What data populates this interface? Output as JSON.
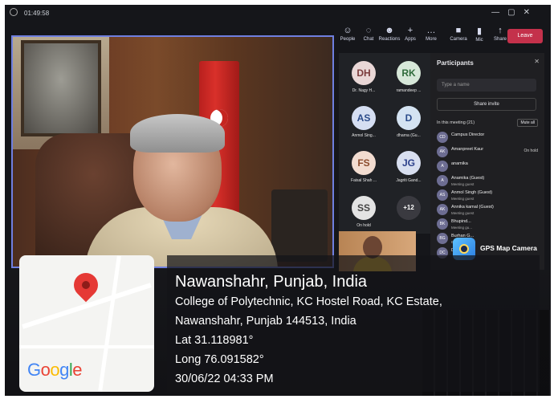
{
  "status_bar": {
    "time": "01:49:58"
  },
  "toolbar": {
    "items": [
      {
        "label": "People",
        "icon": "people-icon",
        "glyph": "☺"
      },
      {
        "label": "Chat",
        "icon": "chat-icon",
        "glyph": "◌"
      },
      {
        "label": "Reactions",
        "icon": "reactions-icon",
        "glyph": "☻"
      },
      {
        "label": "Apps",
        "icon": "apps-icon",
        "glyph": "+"
      },
      {
        "label": "More",
        "icon": "more-icon",
        "glyph": "…"
      },
      {
        "label": "Camera",
        "icon": "camera-icon",
        "glyph": "■"
      },
      {
        "label": "Mic",
        "icon": "mic-icon",
        "glyph": "▮"
      },
      {
        "label": "Share",
        "icon": "share-icon",
        "glyph": "↑"
      }
    ],
    "leave_label": "Leave"
  },
  "video_tiles": [
    {
      "initials": "DH",
      "name": "Dr. Nagy H...",
      "bg": "#e9d7d6",
      "fg": "#7a3b3b"
    },
    {
      "initials": "RK",
      "name": "ramandeep ...",
      "bg": "#d7e8d9",
      "fg": "#2f6b3b"
    },
    {
      "initials": "AS",
      "name": "Anmol Sing...",
      "bg": "#d5def2",
      "fg": "#2b4b8a"
    },
    {
      "initials": "D",
      "name": "dharna (Gu...",
      "bg": "#d4e3f2",
      "fg": "#2b4b8a"
    },
    {
      "initials": "FS",
      "name": "Faisal Shah ...",
      "bg": "#f2dcd0",
      "fg": "#8a4a2b"
    },
    {
      "initials": "JG",
      "name": "Jagriti Gand...",
      "bg": "#d8dff0",
      "fg": "#2b3f8a"
    },
    {
      "initials": "SS",
      "name": "On hold",
      "bg": "#e3e3e3",
      "fg": "#444444"
    },
    {
      "initials": "+12",
      "name": "",
      "bg": "#3a3a40",
      "fg": "#ffffff"
    }
  ],
  "participants_panel": {
    "title": "Participants",
    "search_placeholder": "Type a name",
    "share_invite": "Share invite",
    "in_meeting": "In this meeting (21)",
    "mute_all": "Mute all",
    "people": [
      {
        "initials": "CD",
        "name": "Campus Director",
        "sub": "",
        "state": ""
      },
      {
        "initials": "AK",
        "name": "Amanpreet Kaur",
        "sub": "",
        "state": "On hold"
      },
      {
        "initials": "A",
        "name": "anamika",
        "sub": "",
        "state": ""
      },
      {
        "initials": "A",
        "name": "Anamika (Guest)",
        "sub": "Meeting guest",
        "state": ""
      },
      {
        "initials": "AS",
        "name": "Anmol Singh (Guest)",
        "sub": "Meeting guest",
        "state": ""
      },
      {
        "initials": "AK",
        "name": "Annika kamal (Guest)",
        "sub": "Meeting guest",
        "state": ""
      },
      {
        "initials": "BK",
        "name": "Bhupind...",
        "sub": "Meeting gu...",
        "state": ""
      },
      {
        "initials": "BG",
        "name": "Burhan G...",
        "sub": "External",
        "state": ""
      },
      {
        "initials": "DC",
        "name": "DCA...",
        "sub": "",
        "state": ""
      }
    ]
  },
  "gps_badge": {
    "label": "GPS Map Camera"
  },
  "map_card": {
    "logo": [
      "G",
      "o",
      "o",
      "g",
      "l",
      "e"
    ],
    "logo_colors": [
      "#4285F4",
      "#EA4335",
      "#FBBC05",
      "#4285F4",
      "#34A853",
      "#EA4335"
    ]
  },
  "location": {
    "place": "Nawanshahr, Punjab, India",
    "address_line1": "College of Polytechnic, KC Hostel Road, KC Estate,",
    "address_line2": "Nawanshahr, Punjab 144513, India",
    "lat": "Lat 31.118981°",
    "long": "Long 76.091582°",
    "datetime": "30/06/22 04:33 PM"
  }
}
